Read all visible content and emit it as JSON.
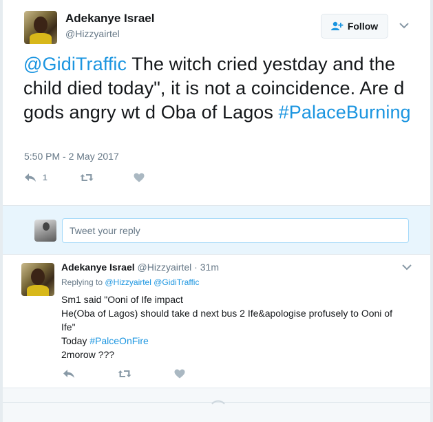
{
  "tweet": {
    "author_name": "Adekanye Israel",
    "author_handle": "@Hizzyairtel",
    "follow_label": "Follow",
    "text_mention": "@GidiTraffic",
    "text_body": " The witch cried yestday and the child died today\", it is not a coincidence. Are d gods angry wt d Oba of Lagos ",
    "text_hashtag": "#PalaceBurning",
    "timestamp": "5:50 PM - 2 May 2017",
    "reply_count": "1"
  },
  "reply_box": {
    "placeholder": "Tweet your reply"
  },
  "reply": {
    "author_name": "Adekanye Israel",
    "author_handle": "@Hizzyairtel",
    "separator": " · ",
    "time_ago": "31m",
    "replying_to_label": "Replying to ",
    "replying_to_1": "@Hizzyairtel",
    "replying_to_2": "@GidiTraffic",
    "line1": "Sm1 said \"Ooni of Ife impact",
    "line2": "He(Oba of Lagos) should take d next bus 2 Ife&apologise profusely to Ooni of Ife\"",
    "line3_prefix": "Today ",
    "line3_hashtag": "#PalceOnFire",
    "line4": "2morow ???"
  },
  "colors": {
    "link": "#1b95e0",
    "text": "#14171a",
    "muted": "#657786",
    "icon": "#aab8c2",
    "reply_bar_bg": "#e8f5fd"
  },
  "icons": [
    "follow-person-plus-icon",
    "chevron-down-icon",
    "reply-icon",
    "retweet-icon",
    "like-heart-icon"
  ]
}
